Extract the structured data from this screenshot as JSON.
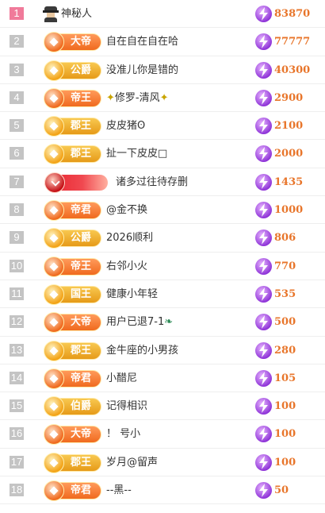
{
  "rows": [
    {
      "rank": "1",
      "badge": null,
      "badge_style": "avatar",
      "name": "神秘人",
      "score": "83870"
    },
    {
      "rank": "2",
      "badge": "大帝",
      "badge_style": "orange",
      "name": "自在自在自在哈",
      "score": "77777"
    },
    {
      "rank": "3",
      "badge": "公爵",
      "badge_style": "gold",
      "name": "没准儿你是错的",
      "score": "40300"
    },
    {
      "rank": "4",
      "badge": "帝王",
      "badge_style": "orange",
      "name": "修罗-清风",
      "score": "2900",
      "deco": "sparkles"
    },
    {
      "rank": "5",
      "badge": "郡王",
      "badge_style": "gold",
      "name": "皮皮猪ʘ",
      "score": "2100"
    },
    {
      "rank": "6",
      "badge": "郡王",
      "badge_style": "gold",
      "name": "扯一下皮皮□",
      "score": "2000"
    },
    {
      "rank": "7",
      "badge": "",
      "badge_style": "red",
      "name": "诸多过往待存删",
      "score": "1435"
    },
    {
      "rank": "8",
      "badge": "帝君",
      "badge_style": "orange",
      "name": "@金不换",
      "score": "1000"
    },
    {
      "rank": "9",
      "badge": "公爵",
      "badge_style": "gold",
      "name": "2026顺利",
      "score": "806"
    },
    {
      "rank": "10",
      "badge": "帝王",
      "badge_style": "orange",
      "name": "右邻小火",
      "score": "770"
    },
    {
      "rank": "11",
      "badge": "国王",
      "badge_style": "gold",
      "name": "健康小年轻",
      "score": "535"
    },
    {
      "rank": "12",
      "badge": "大帝",
      "badge_style": "orange",
      "name": "用户已退7-1",
      "score": "500",
      "deco": "leaf"
    },
    {
      "rank": "13",
      "badge": "郡王",
      "badge_style": "gold",
      "name": "金牛座的小男孩",
      "score": "280"
    },
    {
      "rank": "14",
      "badge": "帝君",
      "badge_style": "orange",
      "name": "小醋尼",
      "score": "105"
    },
    {
      "rank": "15",
      "badge": "伯爵",
      "badge_style": "gold",
      "name": "记得相识",
      "score": "100"
    },
    {
      "rank": "16",
      "badge": "大帝",
      "badge_style": "orange",
      "name": "！ 号小",
      "score": "100"
    },
    {
      "rank": "17",
      "badge": "郡王",
      "badge_style": "gold",
      "name": "岁月@留声",
      "score": "100"
    },
    {
      "rank": "18",
      "badge": "帝君",
      "badge_style": "orange",
      "name": "--黑--",
      "score": "50"
    }
  ],
  "icons": {
    "score_icon": "lightning-bolt-icon",
    "avatar": "mystery-man-icon"
  },
  "colors": {
    "rank_first": "#f07a9a",
    "rank_other": "#c4c4c4",
    "score": "#e8752a"
  }
}
